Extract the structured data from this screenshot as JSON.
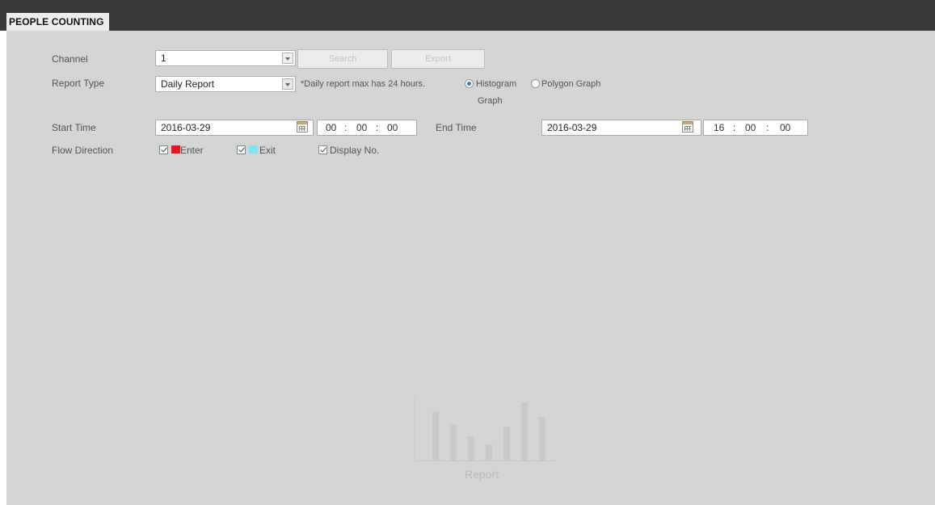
{
  "header": {
    "title": "PEOPLE COUNTING"
  },
  "form": {
    "channel": {
      "label": "Channel",
      "value": "1"
    },
    "search_button": "Search",
    "export_button": "Export",
    "report_type": {
      "label": "Report Type",
      "value": "Daily Report",
      "note": "*Daily report max has 24 hours."
    },
    "graph_type": {
      "histogram_label": "Histogram",
      "polygon_label": "Polygon Graph",
      "graph_word": "Graph",
      "selected": "Histogram"
    },
    "start_time": {
      "label": "Start Time",
      "date": "2016-03-29",
      "hh": "00",
      "mm": "00",
      "ss": "00"
    },
    "end_time": {
      "label": "End Time",
      "date": "2016-03-29",
      "hh": "16",
      "mm": "00",
      "ss": "00"
    },
    "flow_direction": {
      "label": "Flow Direction",
      "enter_label": "Enter",
      "exit_label": "Exit",
      "display_label": "Display No.",
      "enter_color": "#e8141e",
      "exit_color": "#7fe4f0"
    }
  },
  "placeholder": {
    "label": "Report"
  },
  "colors": {
    "topbar": "#3a3a3a",
    "panel": "#d4d4d4",
    "radio_selected": "#3c78c8"
  }
}
